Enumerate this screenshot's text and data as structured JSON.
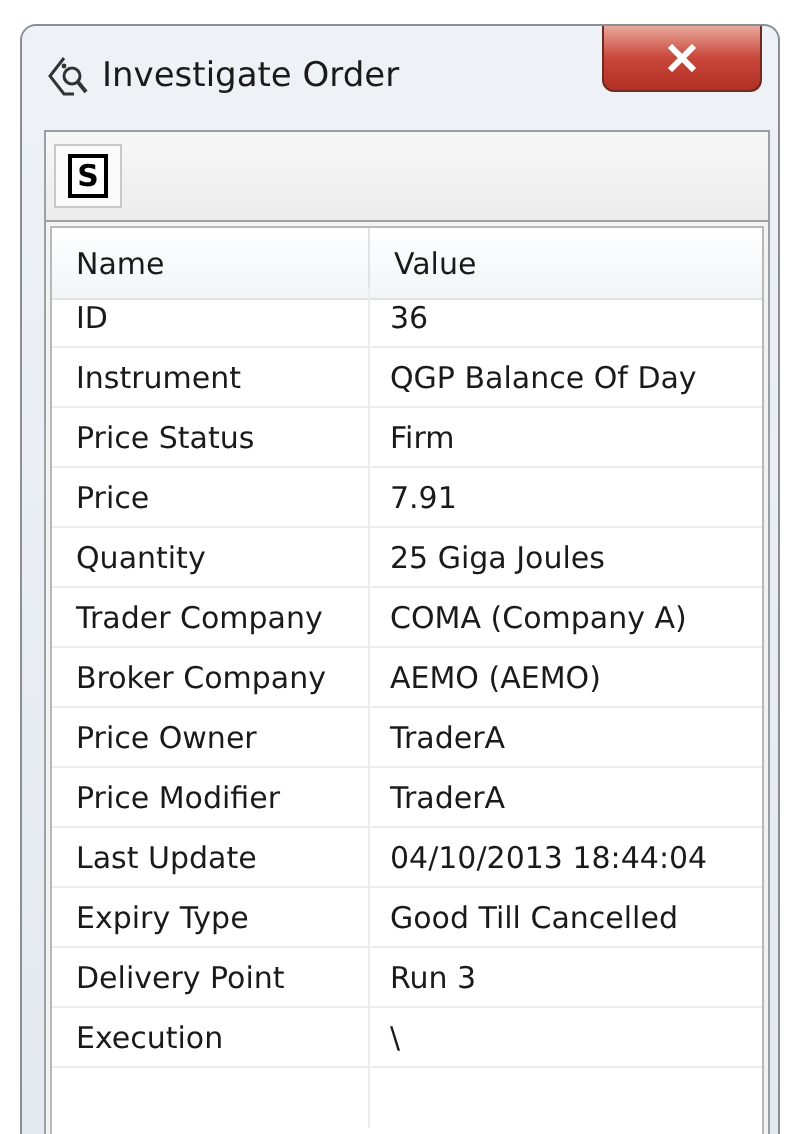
{
  "window": {
    "title": "Investigate Order"
  },
  "toolbar": {
    "button": "S"
  },
  "table": {
    "columns": [
      "Name",
      "Value"
    ],
    "rows": [
      {
        "name": "ID",
        "value": "36"
      },
      {
        "name": "Instrument",
        "value": "QGP Balance Of Day"
      },
      {
        "name": "Price Status",
        "value": "Firm"
      },
      {
        "name": "Price",
        "value": "7.91"
      },
      {
        "name": "Quantity",
        "value": "25 Giga Joules"
      },
      {
        "name": "Trader Company",
        "value": "COMA (Company A)"
      },
      {
        "name": "Broker Company",
        "value": "AEMO (AEMO)"
      },
      {
        "name": "Price Owner",
        "value": "TraderA"
      },
      {
        "name": "Price Modifier",
        "value": "TraderA"
      },
      {
        "name": "Last Update",
        "value": "04/10/2013 18:44:04"
      },
      {
        "name": "Expiry Type",
        "value": "Good Till Cancelled"
      },
      {
        "name": "Delivery Point",
        "value": "Run 3"
      },
      {
        "name": "Execution",
        "value": "\\"
      }
    ]
  }
}
